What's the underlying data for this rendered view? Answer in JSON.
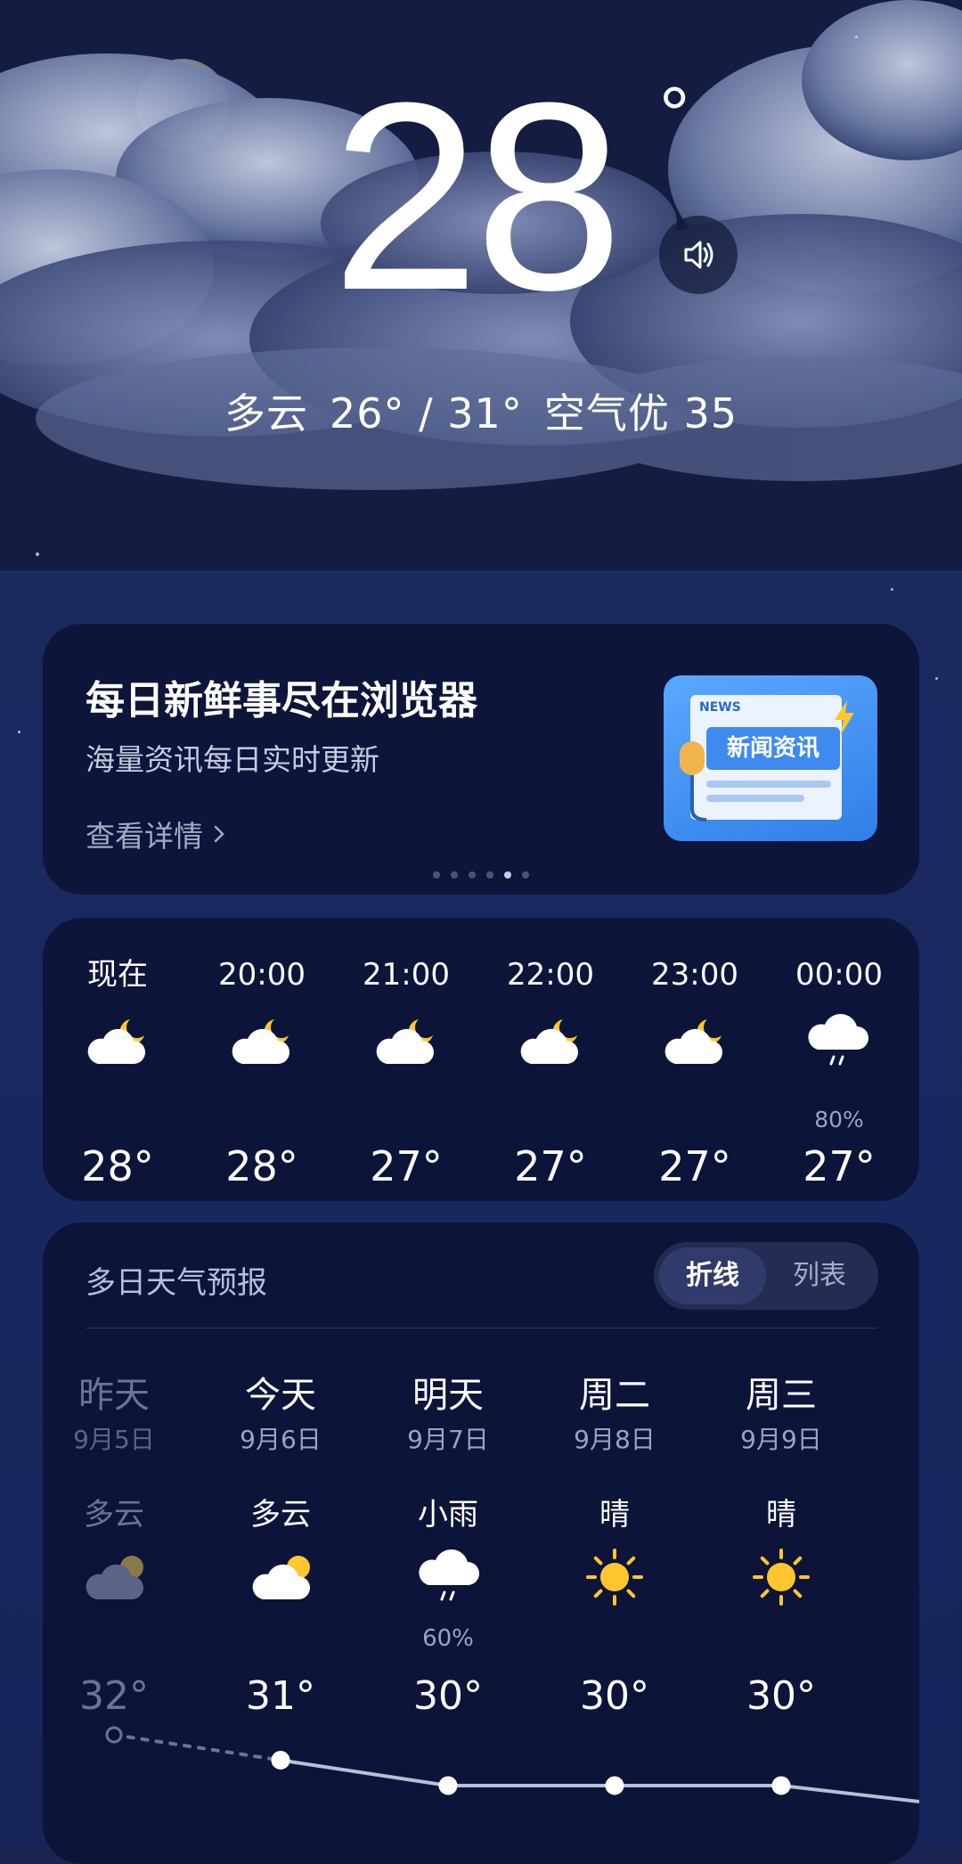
{
  "current": {
    "temperature": "28",
    "degree_symbol": "°",
    "condition": "多云",
    "range": "26° / 31°",
    "air_quality": "空气优 35"
  },
  "speaker": {
    "icon": "speaker-icon"
  },
  "banner": {
    "title": "每日新鲜事尽在浏览器",
    "subtitle": "海量资讯每日实时更新",
    "link_label": "查看详情",
    "image_tag": "NEWS",
    "image_caption": "新闻资讯",
    "page_count": 6,
    "active_page": 5
  },
  "hourly": [
    {
      "time": "现在",
      "icon": "cloudy-night-icon",
      "prob": "",
      "temp": "28°"
    },
    {
      "time": "20:00",
      "icon": "cloudy-night-icon",
      "prob": "",
      "temp": "28°"
    },
    {
      "time": "21:00",
      "icon": "cloudy-night-icon",
      "prob": "",
      "temp": "27°"
    },
    {
      "time": "22:00",
      "icon": "cloudy-night-icon",
      "prob": "",
      "temp": "27°"
    },
    {
      "time": "23:00",
      "icon": "cloudy-night-icon",
      "prob": "",
      "temp": "27°"
    },
    {
      "time": "00:00",
      "icon": "rain-icon",
      "prob": "80%",
      "temp": "27°"
    }
  ],
  "daily": {
    "title": "多日天气预报",
    "toggle": {
      "chart": "折线",
      "list": "列表",
      "selected": "折线"
    },
    "days": [
      {
        "name": "昨天",
        "date": "9月5日",
        "condition": "多云",
        "icon": "cloudy-day-icon",
        "prob": "",
        "high": "32°",
        "high_value": 32,
        "past": true
      },
      {
        "name": "今天",
        "date": "9月6日",
        "condition": "多云",
        "icon": "cloudy-day-icon",
        "prob": "",
        "high": "31°",
        "high_value": 31,
        "past": false
      },
      {
        "name": "明天",
        "date": "9月7日",
        "condition": "小雨",
        "icon": "rain-icon",
        "prob": "60%",
        "high": "30°",
        "high_value": 30,
        "past": false
      },
      {
        "name": "周二",
        "date": "9月8日",
        "condition": "晴",
        "icon": "sun-icon",
        "prob": "",
        "high": "30°",
        "high_value": 30,
        "past": false
      },
      {
        "name": "周三",
        "date": "9月9日",
        "condition": "晴",
        "icon": "sun-icon",
        "prob": "",
        "high": "30°",
        "high_value": 30,
        "past": false
      }
    ]
  },
  "colors": {
    "card_bg": "#0a1030",
    "sun": "#ffc62e",
    "past_text": "#6b7396",
    "trend_line": "#b9bfd6"
  }
}
